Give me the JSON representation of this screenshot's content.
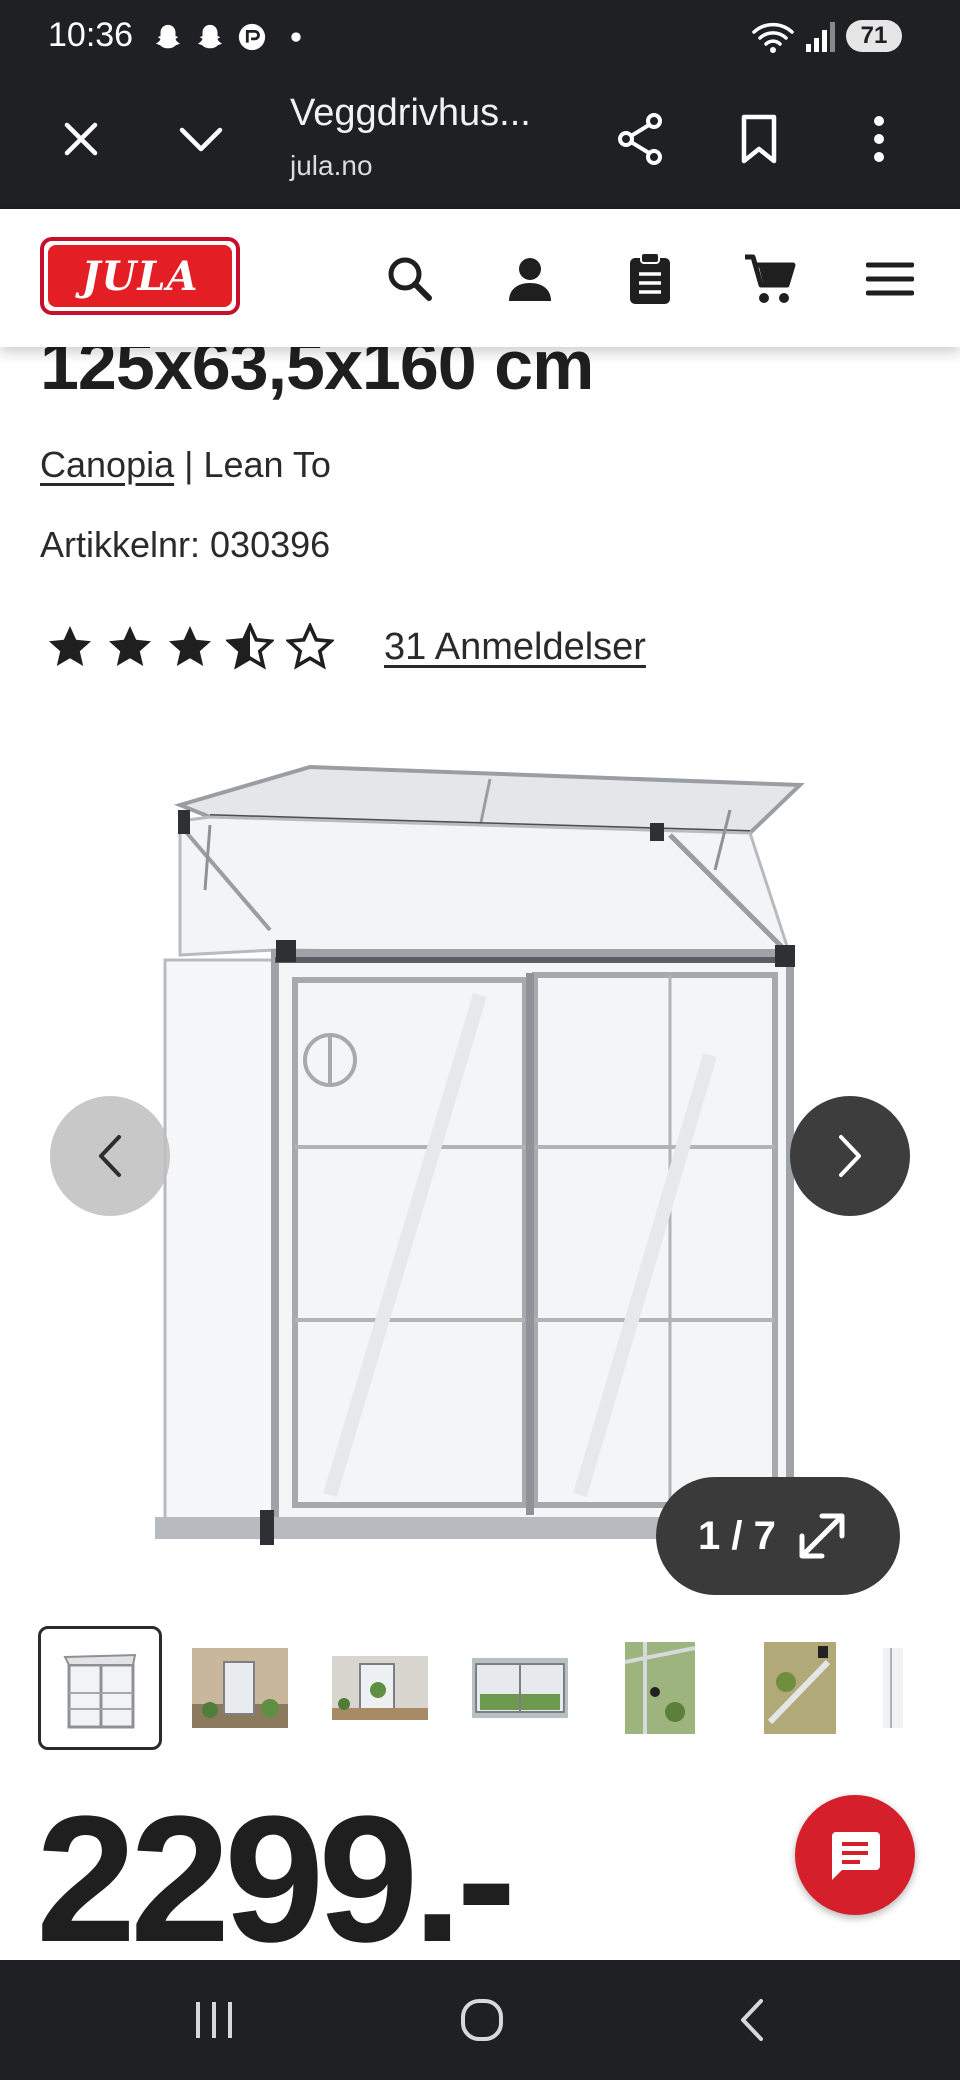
{
  "status_bar": {
    "time": "10:36",
    "battery": "71",
    "notification_icons": [
      "snapchat-icon",
      "snapchat-icon",
      "app-icon",
      "dot-icon"
    ]
  },
  "browser": {
    "page_title": "Veggdrivhus...",
    "url": "jula.no",
    "icons": [
      "close-icon",
      "chevron-down-icon",
      "share-icon",
      "bookmark-icon",
      "more-vert-icon"
    ]
  },
  "site_header": {
    "logo_text": "JULA",
    "icons": [
      "search-icon",
      "account-icon",
      "clipboard-list-icon",
      "cart-icon",
      "menu-icon"
    ]
  },
  "product": {
    "title_partial": "125x63,5x160 cm",
    "brand": "Canopia",
    "series": "| Lean To",
    "article_number": "Artikkelnr: 030396",
    "rating": 4.5,
    "rating_max": 5,
    "reviews_label": "31 Anmeldelser",
    "price": "2299.-"
  },
  "gallery": {
    "counter": "1 / 7",
    "current": 1,
    "total": 7,
    "thumbnail_count": 7
  },
  "colors": {
    "system_bar": "#1f2023",
    "brand_red": "#e31e24",
    "chat_button": "#d5202c",
    "text": "#1f1f1f"
  }
}
